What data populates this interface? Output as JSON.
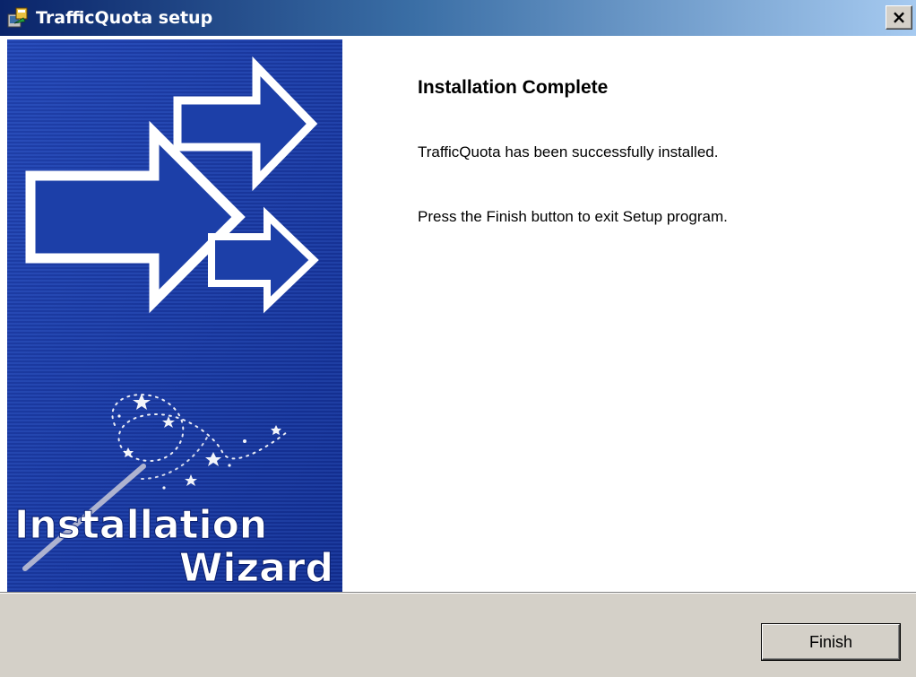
{
  "window": {
    "title": "TrafficQuota setup",
    "close_label": "×"
  },
  "banner": {
    "wordmark_line1": "Installation",
    "wordmark_line2": "Wizard"
  },
  "main": {
    "heading": "Installation Complete",
    "message": "TrafficQuota has been successfully installed.",
    "instruction": "Press the Finish button to exit Setup program."
  },
  "footer": {
    "finish_label": "Finish"
  },
  "colors": {
    "titlebar_start": "#0a246a",
    "titlebar_end": "#a6caf0",
    "banner_blue": "#1c3fa8",
    "dialog_face": "#d4d0c8"
  },
  "icons": [
    "setup-app-icon",
    "close-icon",
    "arrow-icon",
    "magic-wand-icon"
  ]
}
